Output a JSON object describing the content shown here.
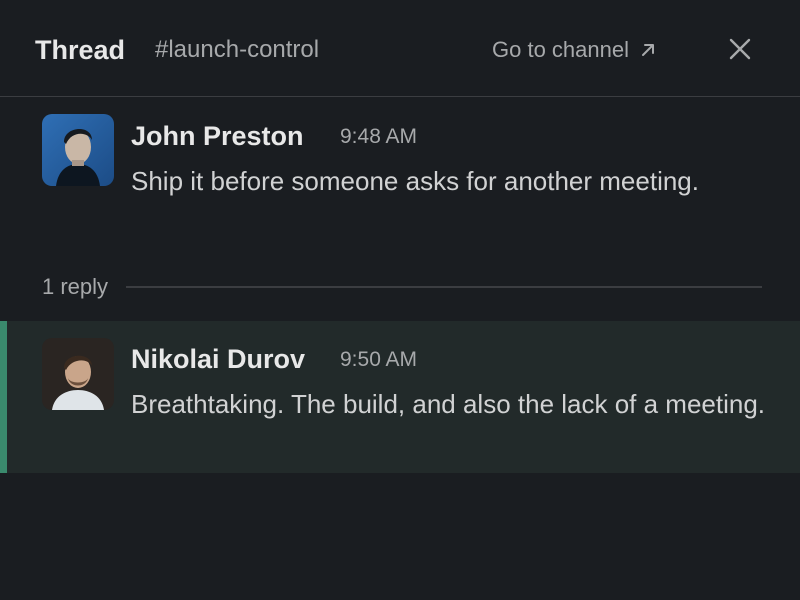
{
  "header": {
    "title": "Thread",
    "channel": "#launch-control",
    "goto_label": "Go to channel",
    "goto_icon": "arrow-up-right-icon",
    "close_icon": "close-icon"
  },
  "messages": [
    {
      "author": "John Preston",
      "time": "9:48 AM",
      "text": "Ship it before someone asks for another meeting.",
      "avatar_icon": "avatar-portrait"
    },
    {
      "author": "Nikolai Durov",
      "time": "9:50 AM",
      "text": "Breathtaking. The build, and also the lack of a meeting.",
      "avatar_icon": "avatar-portrait"
    }
  ],
  "replies": {
    "count_label": "1 reply"
  },
  "colors": {
    "background": "#1a1d21",
    "highlight": "#222a2a",
    "accent": "#3a8a6d",
    "text": "#d1d2d3",
    "muted": "#a7a9ab"
  }
}
